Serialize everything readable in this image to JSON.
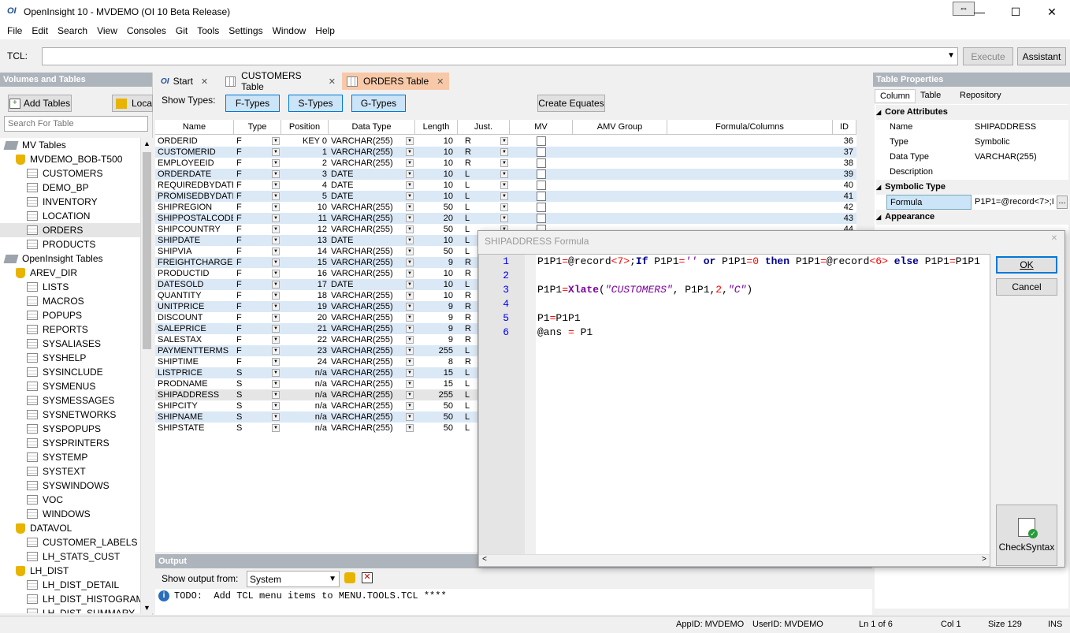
{
  "window": {
    "logo": "OI",
    "title": "OpenInsight 10 - MVDEMO (OI 10 Beta Release)"
  },
  "menu": [
    "File",
    "Edit",
    "Search",
    "View",
    "Consoles",
    "Git",
    "Tools",
    "Settings",
    "Window",
    "Help"
  ],
  "tcl": {
    "label": "TCL:",
    "value": "",
    "execute": "Execute",
    "assistant": "Assistant"
  },
  "left": {
    "header": "Volumes and Tables",
    "add_tables": "Add Tables",
    "local": "Loca",
    "search_placeholder": "Search For Table",
    "tree": [
      {
        "label": "MV Tables",
        "kind": "group",
        "indent": 0
      },
      {
        "label": "MVDEMO_BOB-T500",
        "kind": "db",
        "indent": 1
      },
      {
        "label": "CUSTOMERS",
        "kind": "table",
        "indent": 2
      },
      {
        "label": "DEMO_BP",
        "kind": "table",
        "indent": 2
      },
      {
        "label": "INVENTORY",
        "kind": "table",
        "indent": 2
      },
      {
        "label": "LOCATION",
        "kind": "table",
        "indent": 2
      },
      {
        "label": "ORDERS",
        "kind": "table",
        "indent": 2,
        "selected": true
      },
      {
        "label": "PRODUCTS",
        "kind": "table",
        "indent": 2
      },
      {
        "label": "OpenInsight Tables",
        "kind": "group",
        "indent": 0
      },
      {
        "label": "AREV_DIR",
        "kind": "db",
        "indent": 1
      },
      {
        "label": "LISTS",
        "kind": "table",
        "indent": 2
      },
      {
        "label": "MACROS",
        "kind": "table",
        "indent": 2
      },
      {
        "label": "POPUPS",
        "kind": "table",
        "indent": 2
      },
      {
        "label": "REPORTS",
        "kind": "table",
        "indent": 2
      },
      {
        "label": "SYSALIASES",
        "kind": "table",
        "indent": 2
      },
      {
        "label": "SYSHELP",
        "kind": "table",
        "indent": 2
      },
      {
        "label": "SYSINCLUDE",
        "kind": "table",
        "indent": 2
      },
      {
        "label": "SYSMENUS",
        "kind": "table",
        "indent": 2
      },
      {
        "label": "SYSMESSAGES",
        "kind": "table",
        "indent": 2
      },
      {
        "label": "SYSNETWORKS",
        "kind": "table",
        "indent": 2
      },
      {
        "label": "SYSPOPUPS",
        "kind": "table",
        "indent": 2
      },
      {
        "label": "SYSPRINTERS",
        "kind": "table",
        "indent": 2
      },
      {
        "label": "SYSTEMP",
        "kind": "table",
        "indent": 2
      },
      {
        "label": "SYSTEXT",
        "kind": "table",
        "indent": 2
      },
      {
        "label": "SYSWINDOWS",
        "kind": "table",
        "indent": 2
      },
      {
        "label": "VOC",
        "kind": "table",
        "indent": 2
      },
      {
        "label": "WINDOWS",
        "kind": "table",
        "indent": 2
      },
      {
        "label": "DATAVOL",
        "kind": "db",
        "indent": 1
      },
      {
        "label": "CUSTOMER_LABELS",
        "kind": "table",
        "indent": 2
      },
      {
        "label": "LH_STATS_CUST",
        "kind": "table",
        "indent": 2
      },
      {
        "label": "LH_DIST",
        "kind": "db",
        "indent": 1
      },
      {
        "label": "LH_DIST_DETAIL",
        "kind": "table",
        "indent": 2
      },
      {
        "label": "LH_DIST_HISTOGRAM",
        "kind": "table",
        "indent": 2
      },
      {
        "label": "LH_DIST_SUMMARY",
        "kind": "table",
        "indent": 2
      }
    ]
  },
  "tabs": [
    {
      "label": "Start",
      "icon": "OI"
    },
    {
      "label": "CUSTOMERS Table",
      "icon": "grid"
    },
    {
      "label": "ORDERS Table",
      "icon": "grid",
      "active": true
    }
  ],
  "show_types": {
    "label": "Show Types:",
    "f": "F-Types",
    "s": "S-Types",
    "g": "G-Types",
    "create": "Create Equates"
  },
  "grid": {
    "headers": [
      "Name",
      "Type",
      "Position",
      "Data Type",
      "Length",
      "Just.",
      "MV",
      "AMV Group",
      "Formula/Columns",
      "ID"
    ],
    "rows": [
      [
        "ORDERID",
        "F",
        "KEY 0",
        "VARCHAR(255)",
        "10",
        "R",
        "",
        "",
        "",
        "36"
      ],
      [
        "CUSTOMERID",
        "F",
        "1",
        "VARCHAR(255)",
        "10",
        "R",
        "",
        "",
        "",
        "37"
      ],
      [
        "EMPLOYEEID",
        "F",
        "2",
        "VARCHAR(255)",
        "10",
        "R",
        "",
        "",
        "",
        "38"
      ],
      [
        "ORDERDATE",
        "F",
        "3",
        "DATE",
        "10",
        "L",
        "",
        "",
        "",
        "39"
      ],
      [
        "REQUIREDBYDATE",
        "F",
        "4",
        "DATE",
        "10",
        "L",
        "",
        "",
        "",
        "40"
      ],
      [
        "PROMISEDBYDATE",
        "F",
        "5",
        "DATE",
        "10",
        "L",
        "",
        "",
        "",
        "41"
      ],
      [
        "SHIPREGION",
        "F",
        "10",
        "VARCHAR(255)",
        "50",
        "L",
        "",
        "",
        "",
        "42"
      ],
      [
        "SHIPPOSTALCODE",
        "F",
        "11",
        "VARCHAR(255)",
        "20",
        "L",
        "",
        "",
        "",
        "43"
      ],
      [
        "SHIPCOUNTRY",
        "F",
        "12",
        "VARCHAR(255)",
        "50",
        "L",
        "",
        "",
        "",
        "44"
      ],
      [
        "SHIPDATE",
        "F",
        "13",
        "DATE",
        "10",
        "L",
        "",
        "",
        "",
        ""
      ],
      [
        "SHIPVIA",
        "F",
        "14",
        "VARCHAR(255)",
        "50",
        "L",
        "",
        "",
        "",
        ""
      ],
      [
        "FREIGHTCHARGE",
        "F",
        "15",
        "VARCHAR(255)",
        "9",
        "R",
        "",
        "",
        "",
        ""
      ],
      [
        "PRODUCTID",
        "F",
        "16",
        "VARCHAR(255)",
        "10",
        "R",
        "",
        "",
        "",
        ""
      ],
      [
        "DATESOLD",
        "F",
        "17",
        "DATE",
        "10",
        "L",
        "",
        "",
        "",
        ""
      ],
      [
        "QUANTITY",
        "F",
        "18",
        "VARCHAR(255)",
        "10",
        "R",
        "",
        "",
        "",
        ""
      ],
      [
        "UNITPRICE",
        "F",
        "19",
        "VARCHAR(255)",
        "9",
        "R",
        "",
        "",
        "",
        ""
      ],
      [
        "DISCOUNT",
        "F",
        "20",
        "VARCHAR(255)",
        "9",
        "R",
        "",
        "",
        "",
        ""
      ],
      [
        "SALEPRICE",
        "F",
        "21",
        "VARCHAR(255)",
        "9",
        "R",
        "",
        "",
        "",
        ""
      ],
      [
        "SALESTAX",
        "F",
        "22",
        "VARCHAR(255)",
        "9",
        "R",
        "",
        "",
        "",
        ""
      ],
      [
        "PAYMENTTERMS",
        "F",
        "23",
        "VARCHAR(255)",
        "255",
        "L",
        "",
        "",
        "",
        ""
      ],
      [
        "SHIPTIME",
        "F",
        "24",
        "VARCHAR(255)",
        "8",
        "R",
        "",
        "",
        "",
        ""
      ],
      [
        "LISTPRICE",
        "S",
        "n/a",
        "VARCHAR(255)",
        "15",
        "L",
        "",
        "",
        "",
        ""
      ],
      [
        "PRODNAME",
        "S",
        "n/a",
        "VARCHAR(255)",
        "15",
        "L",
        "",
        "",
        "",
        ""
      ],
      [
        "SHIPADDRESS",
        "S",
        "n/a",
        "VARCHAR(255)",
        "255",
        "L",
        "",
        "",
        "",
        ""
      ],
      [
        "SHIPCITY",
        "S",
        "n/a",
        "VARCHAR(255)",
        "50",
        "L",
        "",
        "",
        "",
        ""
      ],
      [
        "SHIPNAME",
        "S",
        "n/a",
        "VARCHAR(255)",
        "50",
        "L",
        "",
        "",
        "",
        ""
      ],
      [
        "SHIPSTATE",
        "S",
        "n/a",
        "VARCHAR(255)",
        "50",
        "L",
        "",
        "",
        "",
        ""
      ]
    ]
  },
  "output": {
    "header": "Output",
    "show_from": "Show output from:",
    "source": "System",
    "message": "TODO:  Add TCL menu items to MENU.TOOLS.TCL ****"
  },
  "props": {
    "header": "Table Properties",
    "tabs": [
      "Column",
      "Table",
      "Repository"
    ],
    "core": "Core Attributes",
    "name_l": "Name",
    "name_v": "SHIPADDRESS",
    "type_l": "Type",
    "type_v": "Symbolic",
    "dtype_l": "Data Type",
    "dtype_v": "VARCHAR(255)",
    "desc_l": "Description",
    "symbolic": "Symbolic Type",
    "formula_l": "Formula",
    "formula_v": "P1P1=@record<7>;I",
    "appearance": "Appearance"
  },
  "dialog": {
    "title": "SHIPADDRESS Formula",
    "ok": "OK",
    "cancel": "Cancel",
    "check": "CheckSyntax",
    "line_numbers": [
      "1",
      "2",
      "3",
      "4",
      "5",
      "6"
    ]
  },
  "status": {
    "appid": "AppID: MVDEMO",
    "userid": "UserID: MVDEMO",
    "ln": "Ln 1 of 6",
    "col": "Col 1",
    "size": "Size 129",
    "ins": "INS"
  }
}
